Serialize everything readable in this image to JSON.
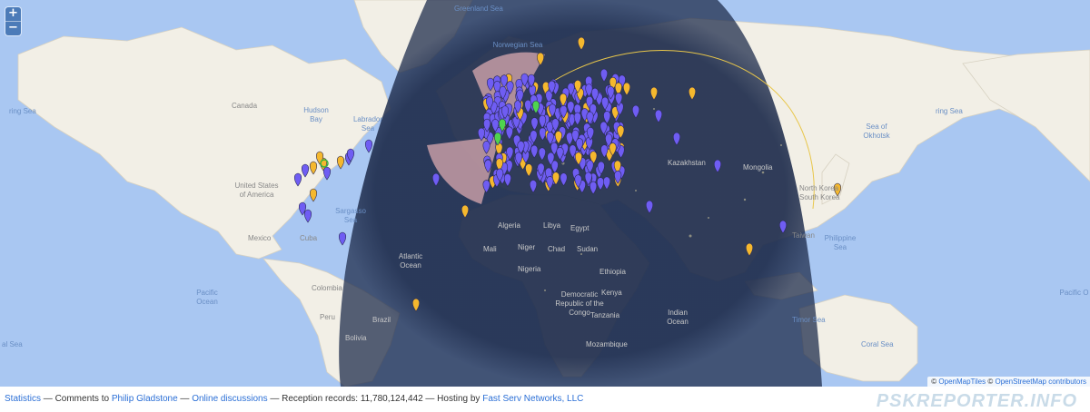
{
  "zoom": {
    "in_label": "+",
    "out_label": "−"
  },
  "attribution": {
    "symbol": "©",
    "tiles": "OpenMapTiles",
    "osm": "OpenStreetMap contributors"
  },
  "labels": {
    "greenland_sea": "Greenland Sea",
    "norwegian_sea": "Norwegian Sea",
    "bering_sea_left": "ring Sea",
    "bering_sea_right": "ring Sea",
    "canada": "Canada",
    "hudson_bay": "Hudson Bay",
    "labrador_sea": "Labrador Sea",
    "sea_of_okhotsk": "Sea of Okhotsk",
    "usa": "United States of America",
    "kazakhstan": "Kazakhstan",
    "mongolia": "Mongolia",
    "north_korea": "North Korea",
    "south_korea": "South Korea",
    "sargasso_sea": "Sargasso Sea",
    "mexico": "Mexico",
    "cuba": "Cuba",
    "atlantic_ocean": "Atlantic Ocean",
    "philippine_sea": "Philippine Sea",
    "taiwan": "Taiwan",
    "libya": "Libya",
    "egypt": "Egypt",
    "pacific_left": "Pacific Ocean",
    "pacific_right": "Pacific O",
    "indian_ocean": "Indian Ocean",
    "colombia": "Colombia",
    "drc": "Democratic Republic of the Congo",
    "tanzania": "Tanzania",
    "mozambique": "Mozambique",
    "coral_sea": "Coral Sea",
    "timor_sea": "Timor Sea",
    "coral_left": "al Sea",
    "algeria": "Algeria",
    "mali": "Mali",
    "niger": "Niger",
    "chad": "Chad",
    "sudan": "Sudan",
    "nigeria": "Nigeria",
    "ethiopia": "Ethiopia",
    "kenya": "Kenya",
    "peru": "Peru",
    "brazil": "Brazil",
    "bolivia": "Bolivia"
  },
  "footer": {
    "statistics": "Statistics",
    "sep1": " — Comments to ",
    "author": "Philip Gladstone",
    "sep2": " — ",
    "discussions": "Online discussions",
    "records_text": " — Reception records: 11,780,124,442 — Hosting by ",
    "host": "Fast Serv Networks, LLC",
    "brand": "PSKREPORTER.INFO"
  },
  "colors": {
    "ocean": "#a9c7f2",
    "land": "#f2efe6",
    "night": "#1f2d4d",
    "marker_purple": "#6f5df3",
    "marker_yellow": "#f5b82e",
    "marker_green": "#4fd34f",
    "sector": "#c59ca6",
    "link": "#2b6fd6"
  },
  "markers": {
    "count_blue_approx": 400,
    "count_yellow_approx": 120,
    "count_green_approx": 4
  }
}
